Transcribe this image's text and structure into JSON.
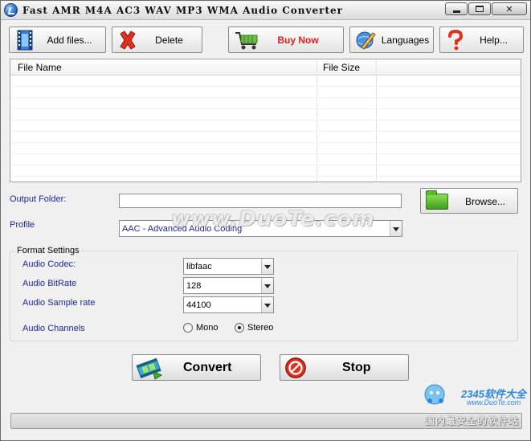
{
  "window": {
    "title": "Fast AMR M4A AC3 WAV MP3 WMA Audio Converter"
  },
  "toolbar": {
    "add_files": "Add files...",
    "delete": "Delete",
    "buy_now": "Buy Now",
    "languages": "Languages",
    "help": "Help..."
  },
  "file_list": {
    "columns": [
      "File Name",
      "File Size"
    ],
    "rows": []
  },
  "output": {
    "folder_label": "Output Folder:",
    "folder_value": "",
    "browse_label": "Browse..."
  },
  "profile": {
    "label": "Profile",
    "selected": "AAC - Advanced Audio Coding"
  },
  "format_settings": {
    "title": "Format Settings",
    "codec_label": "Audio Codec:",
    "codec_value": "libfaac",
    "bitrate_label": "Audio BitRate",
    "bitrate_value": "128",
    "samplerate_label": "Audio Sample rate",
    "samplerate_value": "44100",
    "channels_label": "Audio Channels",
    "channel_options": [
      "Mono",
      "Stereo"
    ],
    "channel_selected": "Stereo"
  },
  "actions": {
    "convert": "Convert",
    "stop": "Stop"
  },
  "progress": {
    "percent": 0
  },
  "watermarks": {
    "center": "www.DuoTe.com",
    "brand": "2345软件大全",
    "url": "www.DuoTe.com",
    "slogan": "国内最安全的软件站"
  },
  "colors": {
    "label_blue": "#1c2a8c",
    "buy_now_red": "#e11d1d",
    "window_bg": "#f0f0f0"
  },
  "icons": {
    "add_files": "film-strip-icon",
    "delete": "red-x-icon",
    "buy_now": "shopping-cart-icon",
    "languages": "globe-pen-icon",
    "help": "question-mark-icon",
    "browse": "folder-icon",
    "convert": "film-arrow-icon",
    "stop": "stop-sign-icon"
  }
}
